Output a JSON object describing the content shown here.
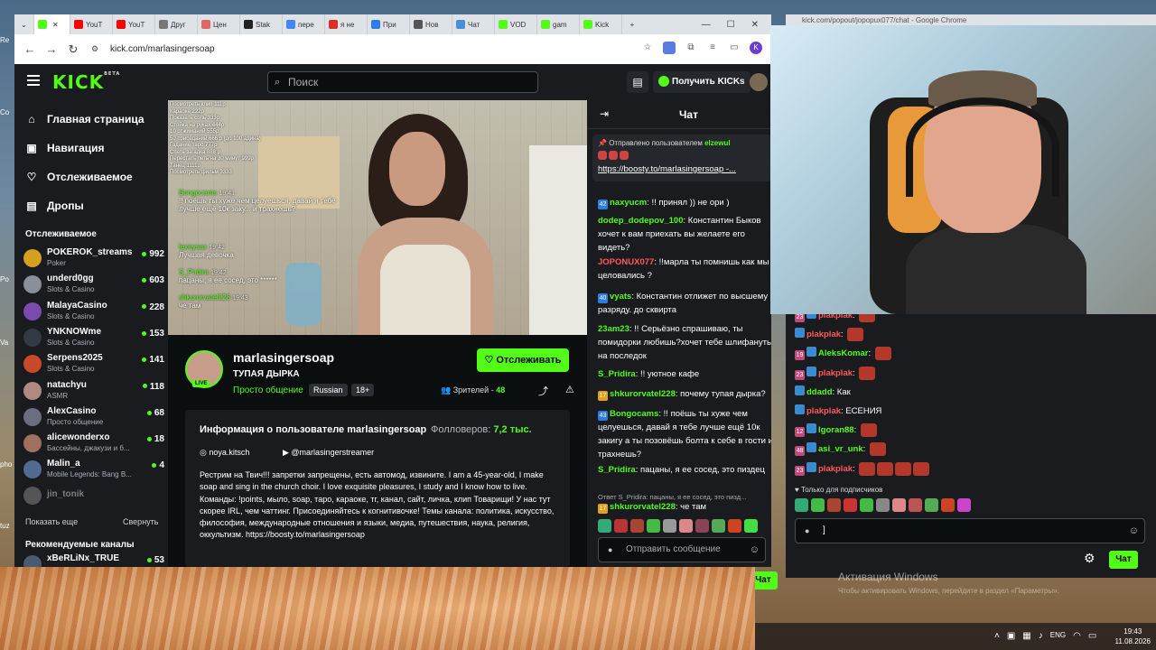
{
  "browser": {
    "tabs": [
      {
        "label": "",
        "color": "#53fc18"
      },
      {
        "label": "YouT",
        "color": "#ff0000"
      },
      {
        "label": "YouT",
        "color": "#ff0000"
      },
      {
        "label": "Друг",
        "color": "#777777"
      },
      {
        "label": "Цен",
        "color": "#e06666"
      },
      {
        "label": "Stak",
        "color": "#222222"
      },
      {
        "label": "пере",
        "color": "#4285f4"
      },
      {
        "label": "я не",
        "color": "#d93025"
      },
      {
        "label": "При",
        "color": "#2b7de9"
      },
      {
        "label": "Нов",
        "color": "#555555"
      },
      {
        "label": "Чат",
        "color": "#4a90d9"
      },
      {
        "label": "VOD",
        "color": "#53fc18"
      },
      {
        "label": "gam",
        "color": "#53fc18"
      },
      {
        "label": "Kick",
        "color": "#53fc18"
      }
    ],
    "url": "kick.com/marlasingersoap",
    "popout_url": "kick.com/popout/jopopux077/chat - Google Chrome"
  },
  "topnav": {
    "logo": "KICK",
    "beta": "BETA",
    "search_placeholder": "Поиск",
    "get_kicks": "Получить KICKs"
  },
  "sidebar": {
    "nav": [
      {
        "label": "Главная страница",
        "icon": "home-icon",
        "glyph": "⌂"
      },
      {
        "label": "Навигация",
        "icon": "browse-icon",
        "glyph": "▣"
      },
      {
        "label": "Отслеживаемое",
        "icon": "heart-icon",
        "glyph": "♡"
      },
      {
        "label": "Дропы",
        "icon": "drops-icon",
        "glyph": "▤"
      }
    ],
    "followed_title": "Отслеживаемое",
    "channels": [
      {
        "name": "POKEROK_streams",
        "cat": "Poker",
        "viewers": "992",
        "color": "#d4a020"
      },
      {
        "name": "underd0gg",
        "cat": "Slots & Casino",
        "viewers": "603",
        "color": "#8a8f99"
      },
      {
        "name": "MalayaCasino",
        "cat": "Slots & Casino",
        "viewers": "228",
        "color": "#7a4ab0"
      },
      {
        "name": "YNKNOWme",
        "cat": "Slots & Casino",
        "viewers": "153",
        "color": "#333a44"
      },
      {
        "name": "Serpens2025",
        "cat": "Slots & Casino",
        "viewers": "141",
        "color": "#c84a2a"
      },
      {
        "name": "natachyu",
        "cat": "ASMR",
        "viewers": "118",
        "color": "#b08a80"
      },
      {
        "name": "AlexCasino",
        "cat": "Просто общение",
        "viewers": "68",
        "color": "#6a6e80"
      },
      {
        "name": "alicewonderxo",
        "cat": "Бассейны, джакузи и б...",
        "viewers": "18",
        "color": "#a07060"
      },
      {
        "name": "Malin_a",
        "cat": "Mobile Legends: Bang B...",
        "viewers": "4",
        "color": "#506a90"
      }
    ],
    "offline_channel": "jin_tonik",
    "show_more": "Показать еще",
    "collapse": "Свернуть",
    "recommended_title": "Рекомендуемые каналы",
    "recommended": [
      {
        "name": "xBeRLiNx_TRUE",
        "viewers": "53"
      }
    ]
  },
  "video": {
    "overlay_lines": [
      "Посмотреть клип 111р",
      "Караоке 222р",
      "Показать соль 333р",
      "Стойка на руках 444р",
      "10 отжиманий 555р",
      "50 приседаний 666 р (до 100 адина)",
      "Гадание таро 777р",
      "Спеть загадка 888 р",
      "Перестать петь на 30 минут 999р",
      "Танец 1111р",
      "Посмотреть фильм 3333"
    ],
    "chat": [
      {
        "user": "Bongocams",
        "time": "19:41",
        "text": "!! поёшь ты хуже чем целуешься, давай я тебе лучше ещё 10к заку... и трахнешь?"
      },
      {
        "user": "lexeysax",
        "time": "19:42",
        "text": "Лучшая девочка"
      },
      {
        "user": "S_Pridira",
        "time": "19:42",
        "text": "пацаны, я ее сосед, это ******"
      },
      {
        "user": "shkurorvatel228",
        "time": "19:43",
        "text": "че там"
      }
    ]
  },
  "channel": {
    "name": "marlasingersoap",
    "title": "ТУПАЯ ДЫРКА",
    "live": "LIVE",
    "category": "Просто общение",
    "tags": [
      "Russian",
      "18+"
    ],
    "follow": "Отслеживать",
    "viewers_label": "Зрителей -",
    "viewers": "48",
    "about_title": "Информация о пользователе marlasingersoap",
    "followers_label": "Фолловеров:",
    "followers": "7,2 тыс.",
    "instagram": "noya.kitsch",
    "youtube": "@marlasingerstreamer",
    "bio": "Рестрим на Твич!!! запретки запрещены, есть автомод, извините. I am a 45-year-old, I make soap and sing in the church choir. I love exquisite pleasures, I study and I know how to live. Команды: !points, мыло, soap, таро, караоке, тг, канал, сайт, личка, клип Товарищи! У нас тут скорее IRL, чем чаттинг. Присоединяйтесь к когнитивочке! Темы канала: политика, искусство, философия, международные отношения и языки, медиа, путешествия, наука, религия, оккультизм. https://boosty.to/marlasingersoap"
  },
  "chat": {
    "title": "Чат",
    "pinned_by": "Отправлено пользователем",
    "pinned_user": "elzewul",
    "pinned_link": "https://boosty.to/marlasingersoap -...",
    "messages": [
      {
        "badge": "42",
        "badge_color": "#2a7de1",
        "user": "naxyucm",
        "user_color": "#53fc18",
        "text": "!! принял )) не ори )"
      },
      {
        "badge": "",
        "badge_color": "",
        "user": "dodep_dodepov_100",
        "user_color": "#53fc18",
        "text": "Константин Быков хочет к вам приехать вы желаете его видеть?"
      },
      {
        "badge": "",
        "badge_color": "",
        "user": "JOPONUX077",
        "user_color": "#ff5a5a",
        "text": "!!марла ты помнишь как мы целовались ?"
      },
      {
        "badge": "40",
        "badge_color": "#2a7de1",
        "user": "vyats",
        "user_color": "#53fc18",
        "text": "Константин отлижет по высшему разряду. до сквирта"
      },
      {
        "badge": "",
        "badge_color": "",
        "user": "23am23",
        "user_color": "#53fc18",
        "text": "!! Серьёзно спрашиваю, ты помидорки любишь?хочет тебе шлифануть на последок"
      },
      {
        "badge": "",
        "badge_color": "",
        "user": "S_Pridira",
        "user_color": "#53fc18",
        "text": "!! уютное кафе"
      },
      {
        "badge": "17",
        "badge_color": "#e0a020",
        "user": "shkurorvatel228",
        "user_color": "#53fc18",
        "text": "почему тупая дырка?"
      },
      {
        "badge": "43",
        "badge_color": "#2a7de1",
        "user": "Bongocams",
        "user_color": "#53fc18",
        "text": "!! поёшь ты хуже чем целуешься, давай я тебе лучше ещё 10к закигу а ты позовёшь болта к себе в гости и трахнешь?"
      },
      {
        "badge": "",
        "badge_color": "",
        "user": "S_Pridira",
        "user_color": "#53fc18",
        "text": "пацаны, я ее сосед, это пиздец"
      }
    ],
    "reply_note": "Ответ S_Pridira: пацаны, я ее сосед, это пизд...",
    "last": {
      "badge": "17",
      "user": "shkurorvatel228",
      "text": "че там"
    },
    "send_placeholder": "Отправить сообщение",
    "send_button": "Чат"
  },
  "popout": {
    "messages": [
      {
        "badge": "23",
        "user": "plakplak",
        "red": true,
        "emotes": 1
      },
      {
        "badge": "",
        "user": "plakplak",
        "red": true,
        "emotes": 1
      },
      {
        "badge": "19",
        "user": "AleksKomar",
        "red": false,
        "emotes": 1
      },
      {
        "badge": "23",
        "user": "plakplak",
        "red": true,
        "emotes": 1
      },
      {
        "badge": "",
        "user": "ddadd",
        "red": false,
        "text": "Как"
      },
      {
        "badge": "",
        "user": "plakplak",
        "red": true,
        "text": "ЕСЕНИЯ"
      },
      {
        "badge": "12",
        "user": "lgoran88",
        "red": false,
        "emotes": 1
      },
      {
        "badge": "48",
        "user": "asi_vr_unk",
        "red": false,
        "emotes": 1
      },
      {
        "badge": "23",
        "user": "plakplak",
        "red": true,
        "emotes": 4
      }
    ],
    "sub_only": "Только для подписчиков",
    "input_value": "]",
    "send_button": "Чат"
  },
  "windows": {
    "activation_title": "Активация Windows",
    "activation_sub": "Чтобы активировать Windows, перейдите в раздел «Параметры».",
    "lang": "ENG",
    "time": "19:43",
    "date": "11.08.2026"
  }
}
